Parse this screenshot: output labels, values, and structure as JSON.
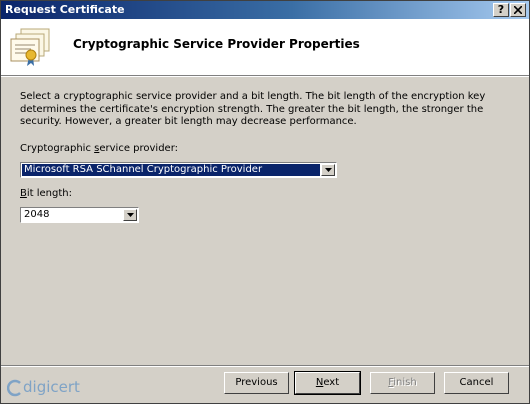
{
  "window": {
    "title": "Request Certificate",
    "help_button": "?",
    "close_button": "X"
  },
  "header": {
    "title": "Cryptographic Service Provider Properties",
    "icon": "certificates-icon"
  },
  "body": {
    "description": "Select a cryptographic service provider and a bit length. The bit length of the encryption key determines the certificate's encryption strength. The greater the bit length, the stronger the security. However, a greater bit length may decrease performance.",
    "csp_label_pre": "Cryptographic ",
    "csp_label_accel": "s",
    "csp_label_post": "ervice provider:",
    "csp_value": "Microsoft RSA SChannel Cryptographic Provider",
    "bit_label_accel": "B",
    "bit_label_post": "it length:",
    "bit_value": "2048"
  },
  "footer": {
    "logo_text": "digicert",
    "previous_label": "Previous",
    "next_label_accel": "N",
    "next_label_post": "ext",
    "finish_label_accel": "F",
    "finish_label_post": "inish",
    "cancel_label": "Cancel"
  },
  "colors": {
    "titlebar": "#0a246a",
    "selection": "#0a246a",
    "logo": "#7fa3c6"
  }
}
